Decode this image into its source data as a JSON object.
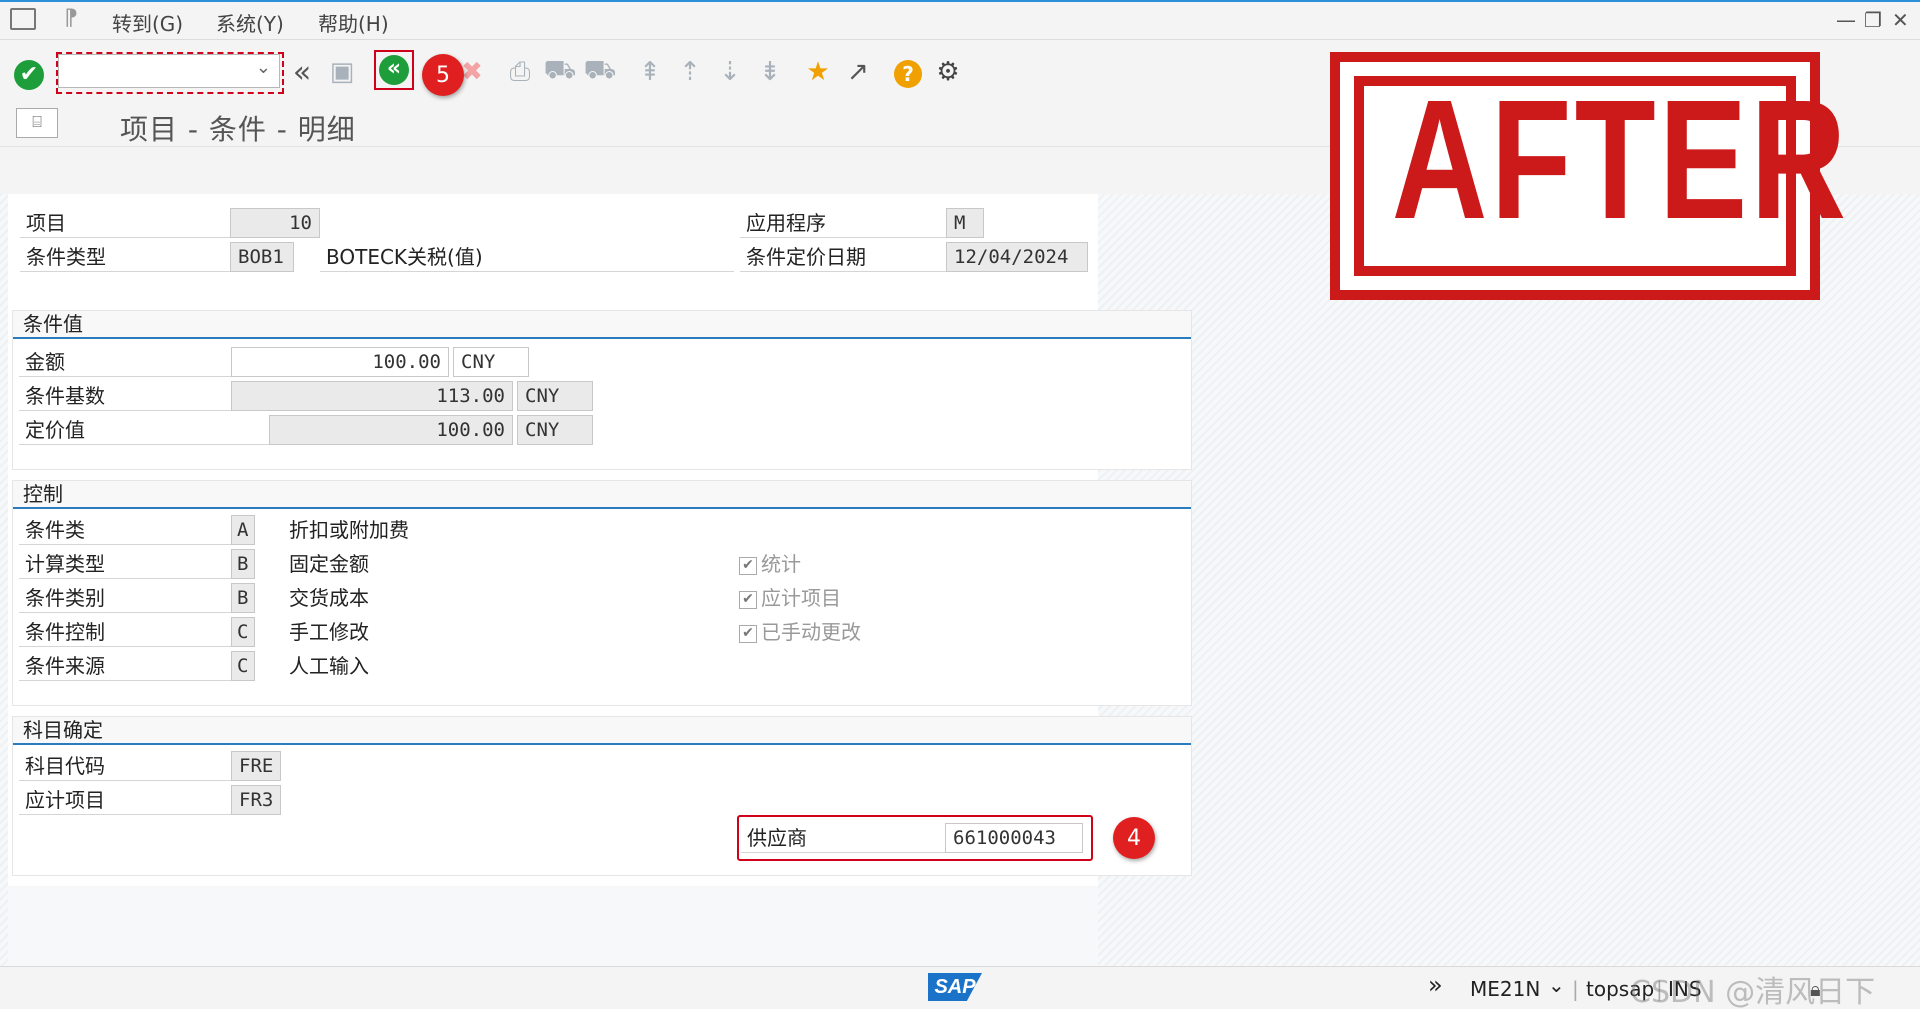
{
  "menu": {
    "items": [
      "转到(G)",
      "系统(Y)",
      "帮助(H)"
    ]
  },
  "toolbar": {
    "command_value": "",
    "badge_5": "5",
    "help_glyph": "?"
  },
  "title": "项目 - 条件 - 明细",
  "stamp": {
    "text": "AFTER"
  },
  "header_fields": {
    "item_label": "项目",
    "item_value": "10",
    "cond_type_label": "条件类型",
    "cond_type_value": "BOB1",
    "cond_type_desc": "BOTECK关税(值)",
    "application_label": "应用程序",
    "application_value": "M",
    "pricing_date_label": "条件定价日期",
    "pricing_date_value": "12/04/2024"
  },
  "condition_values": {
    "heading": "条件值",
    "rows": [
      {
        "label": "金额",
        "value": "100.00",
        "unit": "CNY"
      },
      {
        "label": "条件基数",
        "value": "113.00",
        "unit": "CNY"
      },
      {
        "label": "定价值",
        "value": "100.00",
        "unit": "CNY"
      }
    ]
  },
  "control": {
    "heading": "控制",
    "rows": [
      {
        "label": "条件类",
        "code": "A",
        "desc": "折扣或附加费"
      },
      {
        "label": "计算类型",
        "code": "B",
        "desc": "固定金额"
      },
      {
        "label": "条件类别",
        "code": "B",
        "desc": "交货成本"
      },
      {
        "label": "条件控制",
        "code": "C",
        "desc": "手工修改"
      },
      {
        "label": "条件来源",
        "code": "C",
        "desc": "人工输入"
      }
    ],
    "checkboxes": [
      {
        "label": "统计",
        "checked": true
      },
      {
        "label": "应计项目",
        "checked": true
      },
      {
        "label": "已手动更改",
        "checked": true
      }
    ]
  },
  "account": {
    "heading": "科目确定",
    "rows": [
      {
        "label": "科目代码",
        "value": "FRE"
      },
      {
        "label": "应计项目",
        "value": "FR3"
      }
    ],
    "vendor_label": "供应商",
    "vendor_value": "661000043",
    "badge_4": "4"
  },
  "status": {
    "sap": "SAP",
    "tcode": "ME21N",
    "server": "topsap",
    "mode": "INS",
    "watermark": "CSDN @清风日下"
  },
  "colors": {
    "accent_blue": "#2b7bbf",
    "highlight_red": "#d0021b",
    "stamp_red": "#cc1a1a",
    "ok_green": "#1e9e3a",
    "help_orange": "#f0a000"
  }
}
